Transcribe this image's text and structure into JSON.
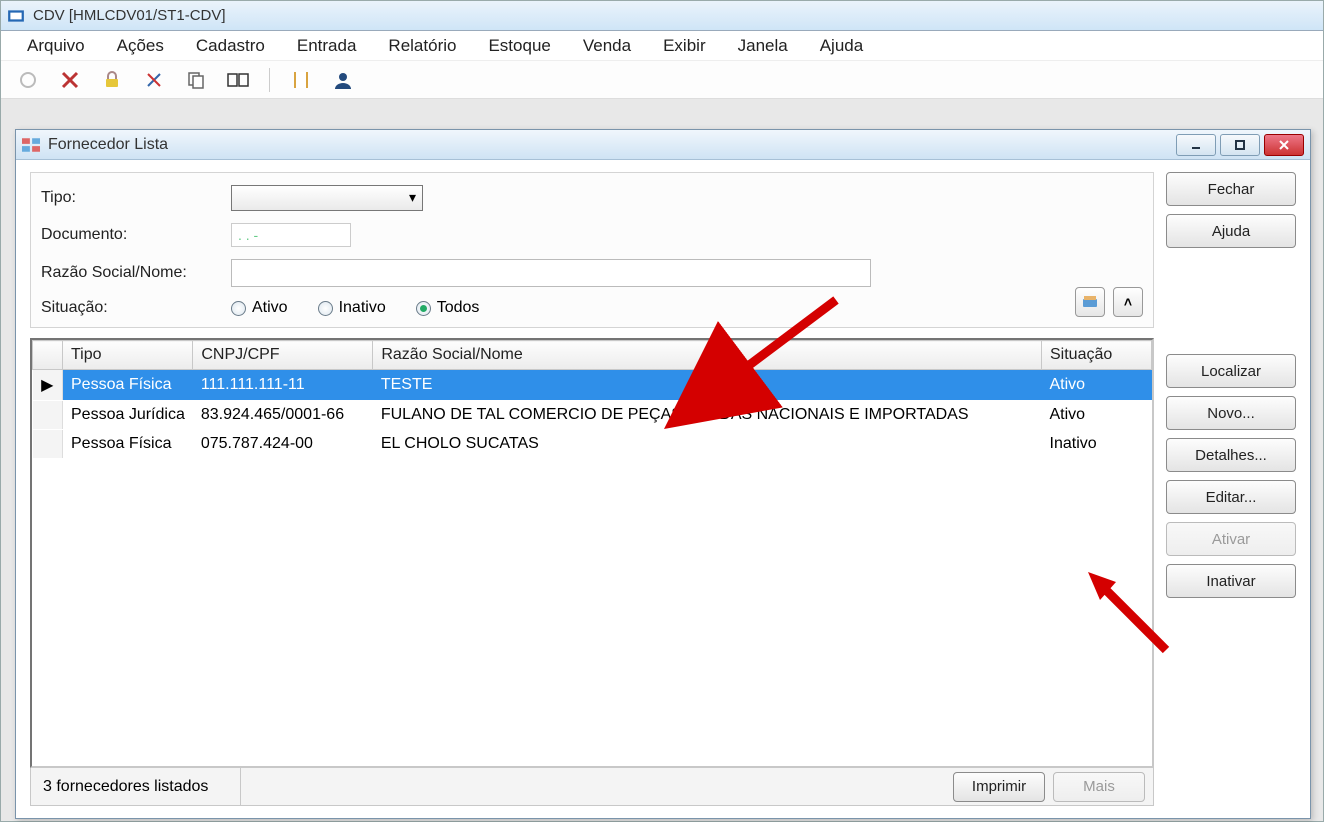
{
  "app": {
    "title": "CDV [HMLCDV01/ST1-CDV]"
  },
  "menu": {
    "items": [
      "Arquivo",
      "Ações",
      "Cadastro",
      "Entrada",
      "Relatório",
      "Estoque",
      "Venda",
      "Exibir",
      "Janela",
      "Ajuda"
    ]
  },
  "modal": {
    "title": "Fornecedor Lista",
    "filters": {
      "tipo_label": "Tipo:",
      "documento_label": "Documento:",
      "documento_mask": ".   .   -",
      "razao_label": "Razão Social/Nome:",
      "situacao_label": "Situação:",
      "radio_ativo": "Ativo",
      "radio_inativo": "Inativo",
      "radio_todos": "Todos"
    },
    "grid": {
      "headers": {
        "tipo": "Tipo",
        "doc": "CNPJ/CPF",
        "razao": "Razão Social/Nome",
        "sit": "Situação"
      },
      "rows": [
        {
          "marker": "▶",
          "tipo": "Pessoa Física",
          "doc": "111.111.111-11",
          "razao": "TESTE",
          "sit": "Ativo",
          "selected": true
        },
        {
          "marker": "",
          "tipo": "Pessoa Jurídica",
          "doc": "83.924.465/0001-66",
          "razao": "FULANO DE TAL COMERCIO DE PEÇAS USADAS NACIONAIS E IMPORTADAS",
          "sit": "Ativo",
          "selected": false
        },
        {
          "marker": "",
          "tipo": "Pessoa Física",
          "doc": "075.787.424-00",
          "razao": "EL CHOLO SUCATAS",
          "sit": "Inativo",
          "selected": false
        }
      ],
      "status": "3 fornecedores listados",
      "print": "Imprimir",
      "more": "Mais"
    },
    "buttons": {
      "fechar": "Fechar",
      "ajuda": "Ajuda",
      "localizar": "Localizar",
      "novo": "Novo...",
      "detalhes": "Detalhes...",
      "editar": "Editar...",
      "ativar": "Ativar",
      "inativar": "Inativar"
    }
  }
}
